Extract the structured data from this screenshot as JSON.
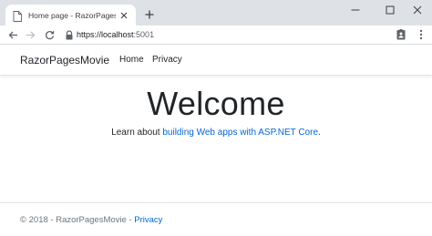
{
  "browser": {
    "tab_title": "Home page - RazorPagesMovie",
    "address_scheme": "https://",
    "address_host": "localhost",
    "address_port": ":5001",
    "icons": [
      "page-icon",
      "close-icon",
      "plus-icon",
      "minimize-icon",
      "maximize-icon",
      "close-window-icon",
      "back-arrow-icon",
      "forward-arrow-icon",
      "reload-icon",
      "lock-icon",
      "profile-icon",
      "menu-icon"
    ]
  },
  "navbar": {
    "brand": "RazorPagesMovie",
    "links": [
      "Home",
      "Privacy"
    ]
  },
  "main": {
    "heading": "Welcome",
    "learn_prefix": "Learn about ",
    "learn_link": "building Web apps with ASP.NET Core",
    "learn_suffix": "."
  },
  "footer": {
    "text": "© 2018 - RazorPagesMovie - ",
    "link": "Privacy"
  },
  "colors": {
    "link": "#0366d6",
    "tabstrip": "#dee1e6"
  }
}
